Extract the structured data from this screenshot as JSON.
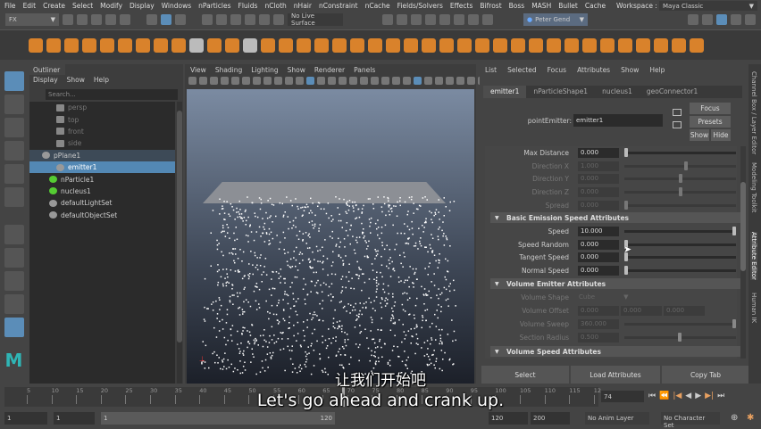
{
  "menubar": [
    "File",
    "Edit",
    "Create",
    "Select",
    "Modify",
    "Display",
    "Windows",
    "nParticles",
    "Fluids",
    "nCloth",
    "nHair",
    "nConstraint",
    "nCache",
    "Fields/Solvers",
    "Effects",
    "Bifrost",
    "Boss",
    "MASH",
    "Bullet",
    "Cache"
  ],
  "workspace": {
    "label": "Workspace :",
    "value": "Maya Classic"
  },
  "toolbar": {
    "mode": "FX",
    "live_surface": "No Live Surface",
    "user": "Peter Gend"
  },
  "outliner": {
    "tab": "Outliner",
    "menu": [
      "Display",
      "Show",
      "Help"
    ],
    "search_placeholder": "Search...",
    "items": [
      {
        "label": "persp",
        "cls": "dim"
      },
      {
        "label": "top",
        "cls": "dim"
      },
      {
        "label": "front",
        "cls": "dim"
      },
      {
        "label": "side",
        "cls": "dim"
      },
      {
        "label": "pPlane1",
        "cls": "par"
      },
      {
        "label": "emitter1",
        "cls": "sel"
      },
      {
        "label": "nParticle1",
        "cls": ""
      },
      {
        "label": "nucleus1",
        "cls": ""
      },
      {
        "label": "defaultLightSet",
        "cls": ""
      },
      {
        "label": "defaultObjectSet",
        "cls": ""
      }
    ]
  },
  "viewport": {
    "menu": [
      "View",
      "Shading",
      "Lighting",
      "Show",
      "Renderer",
      "Panels"
    ]
  },
  "ae": {
    "menu": [
      "List",
      "Selected",
      "Focus",
      "Attributes",
      "Show",
      "Help"
    ],
    "tabs": [
      "emitter1",
      "nParticleShape1",
      "nucleus1",
      "geoConnector1"
    ],
    "node_label": "pointEmitter:",
    "node_value": "emitter1",
    "focus": "Focus",
    "presets": "Presets",
    "show": "Show",
    "hide": "Hide",
    "rows1": [
      {
        "label": "Max Distance",
        "value": "0.000",
        "dim": false,
        "pos": 0
      },
      {
        "label": "Direction X",
        "value": "1.000",
        "dim": true,
        "pos": 0.55
      },
      {
        "label": "Direction Y",
        "value": "0.000",
        "dim": true,
        "pos": 0.5
      },
      {
        "label": "Direction Z",
        "value": "0.000",
        "dim": true,
        "pos": 0.5
      },
      {
        "label": "Spread",
        "value": "0.000",
        "dim": true,
        "pos": 0
      }
    ],
    "sec_basic": "Basic Emission Speed Attributes",
    "rows2": [
      {
        "label": "Speed",
        "value": "10.000",
        "dim": false,
        "pos": 1
      },
      {
        "label": "Speed Random",
        "value": "0.000",
        "dim": false,
        "pos": 0
      },
      {
        "label": "Tangent Speed",
        "value": "0.000",
        "dim": false,
        "pos": 0
      },
      {
        "label": "Normal Speed",
        "value": "0.000",
        "dim": false,
        "pos": 0
      }
    ],
    "sec_volume": "Volume Emitter Attributes",
    "volume_shape": {
      "label": "Volume Shape",
      "value": "Cube"
    },
    "volume_offset": {
      "label": "Volume Offset",
      "values": [
        "0.000",
        "0.000",
        "0.000"
      ]
    },
    "volume_sweep": {
      "label": "Volume Sweep",
      "value": "360.000",
      "pos": 1
    },
    "section_radius": {
      "label": "Section Radius",
      "value": "0.500",
      "pos": 0.5
    },
    "sec_vspeed": "Volume Speed Attributes",
    "buttons": [
      "Select",
      "Load Attributes",
      "Copy Tab"
    ]
  },
  "sidetabs": [
    "Channel Box / Layer Editor",
    "Modeling Toolkit",
    "Attribute Editor",
    "Human IK"
  ],
  "timeline": {
    "ticks": [
      "5",
      "10",
      "15",
      "20",
      "25",
      "30",
      "35",
      "40",
      "45",
      "50",
      "55",
      "60",
      "65",
      "70",
      "75",
      "80",
      "85",
      "90",
      "95",
      "100",
      "105",
      "110",
      "115",
      "12"
    ],
    "current_frame": "74"
  },
  "range": {
    "start": "1",
    "start2": "1",
    "slider_start": "1",
    "slider_end": "120",
    "end": "120",
    "end2": "200",
    "anim_layer": "No Anim Layer",
    "char_set": "No Character Set"
  },
  "subtitles": {
    "zh": "让我们开始吧",
    "en": "Let's go ahead and crank up."
  }
}
